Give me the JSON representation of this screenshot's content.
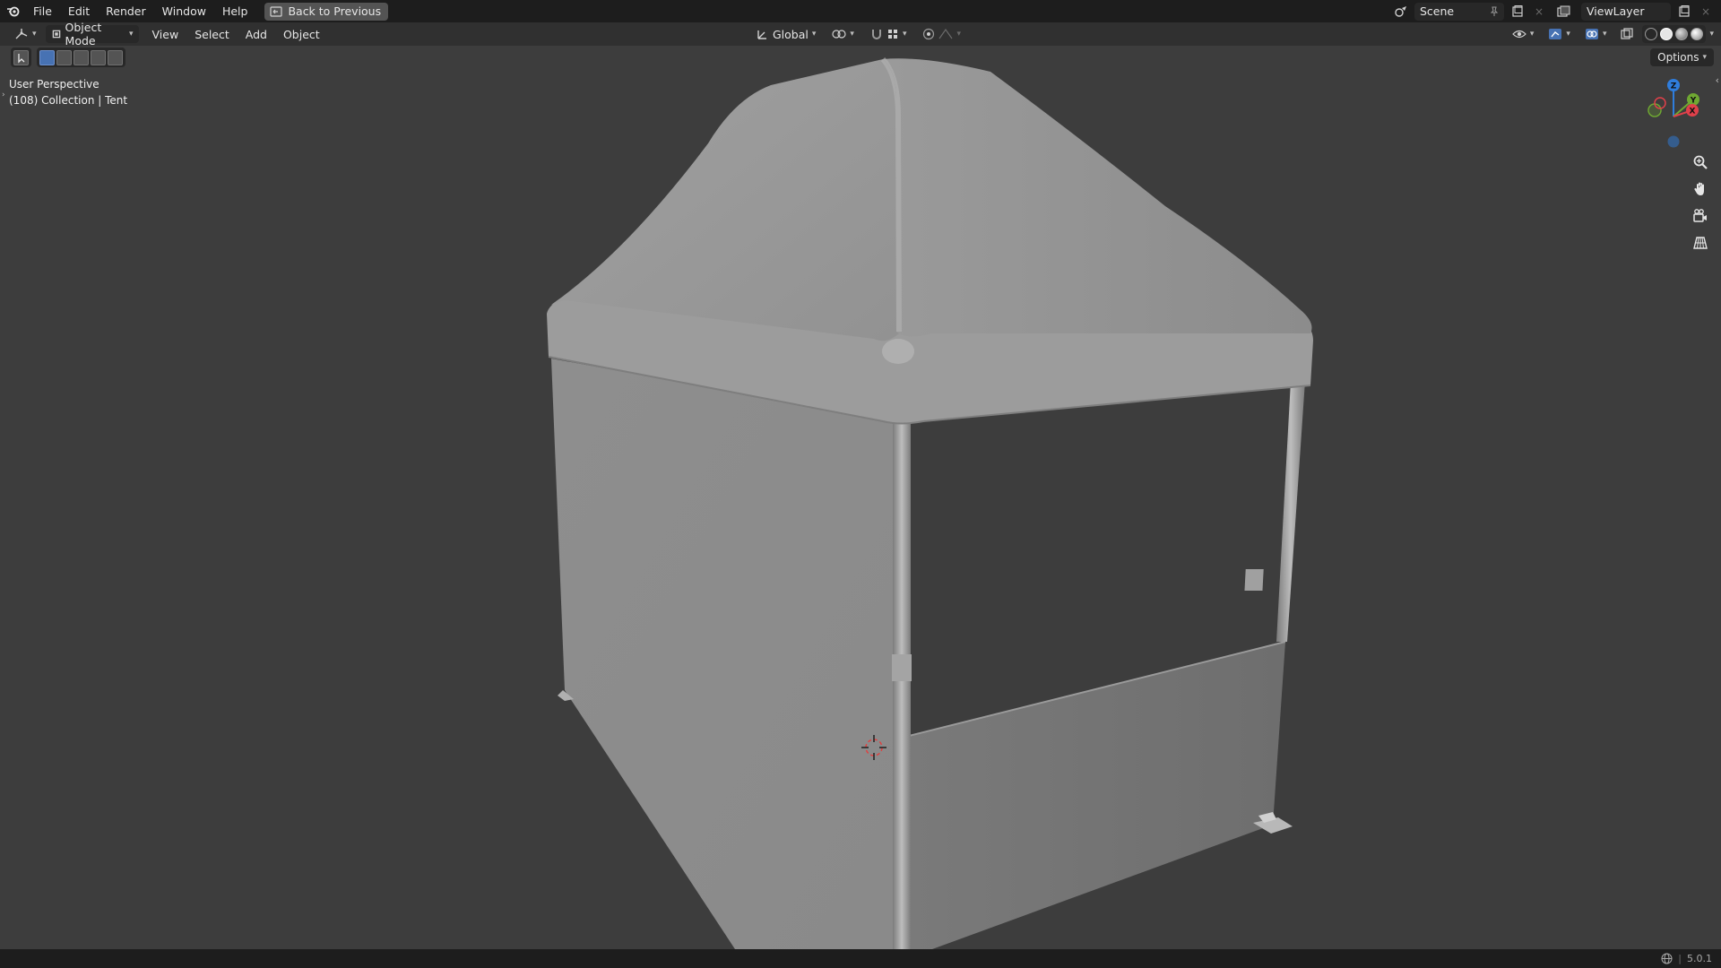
{
  "menubar": {
    "items": [
      "File",
      "Edit",
      "Render",
      "Window",
      "Help"
    ],
    "back_button": "Back to Previous",
    "scene": "Scene",
    "view_layer": "ViewLayer"
  },
  "header": {
    "mode": "Object Mode",
    "menus": [
      "View",
      "Select",
      "Add",
      "Object"
    ],
    "orientation": "Global"
  },
  "viewport": {
    "perspective": "User Perspective",
    "collection_info": "(108) Collection | Tent",
    "options": "Options",
    "gizmo_axes": {
      "z": "Z",
      "x": "X",
      "y": "Y"
    }
  },
  "statusbar": {
    "version": "5.0.1"
  },
  "colors": {
    "background": "#3d3d3d",
    "topbar": "#1d1d1d",
    "header": "#303030",
    "mesh": "#9a9a9a",
    "axis_x": "#e0404a",
    "axis_y": "#6fa832",
    "axis_z": "#2f7ddc",
    "selection_blue": "#4772b3"
  }
}
